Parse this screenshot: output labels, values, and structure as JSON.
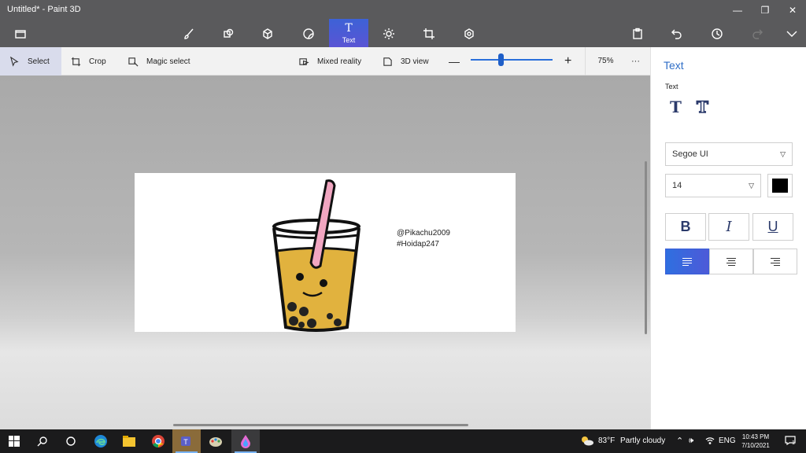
{
  "window": {
    "title": "Untitled* - Paint 3D"
  },
  "toolbar": {
    "icons": [
      "menu-folder-icon",
      "brushes-icon",
      "2d-shapes-icon",
      "3d-shapes-icon",
      "stickers-icon",
      "text-icon",
      "effects-icon",
      "canvas-icon",
      "3d-library-icon",
      "paste-icon",
      "undo-icon",
      "history-icon",
      "redo-icon",
      "expand-icon"
    ],
    "active_tool_label": "Text",
    "active_tool_glyph": "T"
  },
  "subtoolbar": {
    "select_label": "Select",
    "crop_label": "Crop",
    "magic_select_label": "Magic select",
    "mixed_reality_label": "Mixed reality",
    "view3d_label": "3D view",
    "zoom_minus": "—",
    "zoom_plus": "+",
    "zoom_value": "75%",
    "zoom_slider_level": 0.35,
    "more": "···"
  },
  "canvas": {
    "text_line1": "@Pikachu2009",
    "text_line2": "#Hoidap247"
  },
  "panel": {
    "title": "Text",
    "subtitle": "Text",
    "tool_2d_glyph": "T",
    "tool_3d_glyph": "T",
    "font_family": "Segoe UI",
    "font_size": "14",
    "color": "#000000",
    "bold": "B",
    "italic": "I",
    "underline": "U",
    "alignment": "left"
  },
  "taskbar": {
    "weather_temp": "83°F",
    "weather_text": "Partly cloudy",
    "language": "ENG",
    "time": "10:43 PM",
    "date": "7/10/2021",
    "notifications": "1"
  },
  "colors": {
    "accent": "#2f6ec7",
    "titlebar": "#5a5a5c",
    "taskbar": "#1b1b1c",
    "tea": "#e1b23e",
    "straw": "#f1a6c1"
  }
}
